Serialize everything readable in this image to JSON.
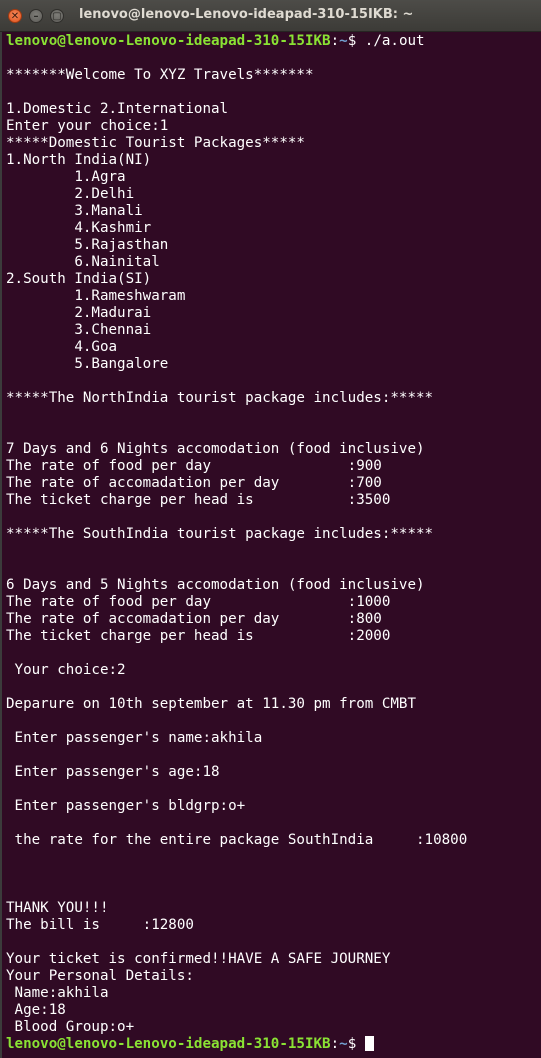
{
  "window": {
    "title": "lenovo@lenovo-Lenovo-ideapad-310-15IKB: ~",
    "close_glyph": "✕",
    "minimize_glyph": "–",
    "maximize_glyph": "▢"
  },
  "prompt": {
    "user_host": "lenovo@lenovo-Lenovo-ideapad-310-15IKB",
    "colon": ":",
    "path": "~",
    "symbol": "$ "
  },
  "command": "./a.out",
  "output": [
    "*******Welcome To XYZ Travels*******",
    "1.Domestic 2.International",
    "Enter your choice:1",
    "*****Domestic Tourist Packages*****",
    "1.North India(NI)",
    "        1.Agra",
    "        2.Delhi",
    "        3.Manali",
    "        4.Kashmir",
    "        5.Rajasthan",
    "        6.Nainital",
    "2.South India(SI)",
    "        1.Rameshwaram",
    "        2.Madurai",
    "        3.Chennai",
    "        4.Goa",
    "        5.Bangalore",
    "*****The NorthIndia tourist package includes:*****",
    "7 Days and 6 Nights accomodation (food inclusive)",
    "The rate of food per day                :900",
    "The rate of accomadation per day        :700",
    "The ticket charge per head is           :3500",
    "*****The SouthIndia tourist package includes:*****",
    "6 Days and 5 Nights accomodation (food inclusive)",
    "The rate of food per day                :1000",
    "The rate of accomadation per day        :800",
    "The ticket charge per head is           :2000",
    " Your choice:2",
    "Deparure on 10th september at 11.30 pm from CMBT",
    " Enter passenger's name:akhila",
    " Enter passenger's age:18",
    " Enter passenger's bldgrp:o+",
    " the rate for the entire package SouthIndia     :10800",
    "THANK YOU!!!",
    "The bill is     :12800",
    "Your ticket is confirmed!!HAVE A SAFE JOURNEY",
    "Your Personal Details:",
    " Name:akhila",
    " Age:18",
    " Blood Group:o+"
  ]
}
